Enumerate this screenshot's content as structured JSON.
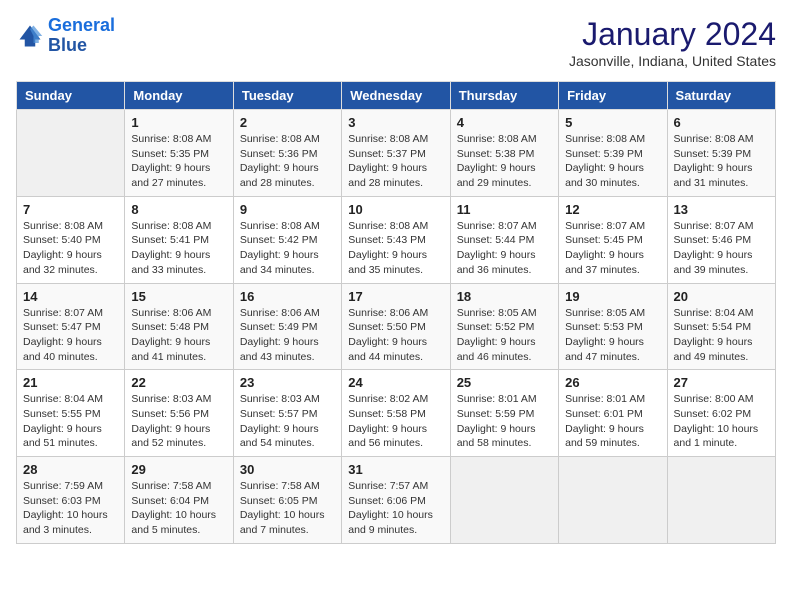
{
  "header": {
    "logo_line1": "General",
    "logo_line2": "Blue",
    "title": "January 2024",
    "subtitle": "Jasonville, Indiana, United States"
  },
  "weekdays": [
    "Sunday",
    "Monday",
    "Tuesday",
    "Wednesday",
    "Thursday",
    "Friday",
    "Saturday"
  ],
  "weeks": [
    [
      {
        "day": "",
        "sunrise": "",
        "sunset": "",
        "daylight": ""
      },
      {
        "day": "1",
        "sunrise": "Sunrise: 8:08 AM",
        "sunset": "Sunset: 5:35 PM",
        "daylight": "Daylight: 9 hours and 27 minutes."
      },
      {
        "day": "2",
        "sunrise": "Sunrise: 8:08 AM",
        "sunset": "Sunset: 5:36 PM",
        "daylight": "Daylight: 9 hours and 28 minutes."
      },
      {
        "day": "3",
        "sunrise": "Sunrise: 8:08 AM",
        "sunset": "Sunset: 5:37 PM",
        "daylight": "Daylight: 9 hours and 28 minutes."
      },
      {
        "day": "4",
        "sunrise": "Sunrise: 8:08 AM",
        "sunset": "Sunset: 5:38 PM",
        "daylight": "Daylight: 9 hours and 29 minutes."
      },
      {
        "day": "5",
        "sunrise": "Sunrise: 8:08 AM",
        "sunset": "Sunset: 5:39 PM",
        "daylight": "Daylight: 9 hours and 30 minutes."
      },
      {
        "day": "6",
        "sunrise": "Sunrise: 8:08 AM",
        "sunset": "Sunset: 5:39 PM",
        "daylight": "Daylight: 9 hours and 31 minutes."
      }
    ],
    [
      {
        "day": "7",
        "sunrise": "Sunrise: 8:08 AM",
        "sunset": "Sunset: 5:40 PM",
        "daylight": "Daylight: 9 hours and 32 minutes."
      },
      {
        "day": "8",
        "sunrise": "Sunrise: 8:08 AM",
        "sunset": "Sunset: 5:41 PM",
        "daylight": "Daylight: 9 hours and 33 minutes."
      },
      {
        "day": "9",
        "sunrise": "Sunrise: 8:08 AM",
        "sunset": "Sunset: 5:42 PM",
        "daylight": "Daylight: 9 hours and 34 minutes."
      },
      {
        "day": "10",
        "sunrise": "Sunrise: 8:08 AM",
        "sunset": "Sunset: 5:43 PM",
        "daylight": "Daylight: 9 hours and 35 minutes."
      },
      {
        "day": "11",
        "sunrise": "Sunrise: 8:07 AM",
        "sunset": "Sunset: 5:44 PM",
        "daylight": "Daylight: 9 hours and 36 minutes."
      },
      {
        "day": "12",
        "sunrise": "Sunrise: 8:07 AM",
        "sunset": "Sunset: 5:45 PM",
        "daylight": "Daylight: 9 hours and 37 minutes."
      },
      {
        "day": "13",
        "sunrise": "Sunrise: 8:07 AM",
        "sunset": "Sunset: 5:46 PM",
        "daylight": "Daylight: 9 hours and 39 minutes."
      }
    ],
    [
      {
        "day": "14",
        "sunrise": "Sunrise: 8:07 AM",
        "sunset": "Sunset: 5:47 PM",
        "daylight": "Daylight: 9 hours and 40 minutes."
      },
      {
        "day": "15",
        "sunrise": "Sunrise: 8:06 AM",
        "sunset": "Sunset: 5:48 PM",
        "daylight": "Daylight: 9 hours and 41 minutes."
      },
      {
        "day": "16",
        "sunrise": "Sunrise: 8:06 AM",
        "sunset": "Sunset: 5:49 PM",
        "daylight": "Daylight: 9 hours and 43 minutes."
      },
      {
        "day": "17",
        "sunrise": "Sunrise: 8:06 AM",
        "sunset": "Sunset: 5:50 PM",
        "daylight": "Daylight: 9 hours and 44 minutes."
      },
      {
        "day": "18",
        "sunrise": "Sunrise: 8:05 AM",
        "sunset": "Sunset: 5:52 PM",
        "daylight": "Daylight: 9 hours and 46 minutes."
      },
      {
        "day": "19",
        "sunrise": "Sunrise: 8:05 AM",
        "sunset": "Sunset: 5:53 PM",
        "daylight": "Daylight: 9 hours and 47 minutes."
      },
      {
        "day": "20",
        "sunrise": "Sunrise: 8:04 AM",
        "sunset": "Sunset: 5:54 PM",
        "daylight": "Daylight: 9 hours and 49 minutes."
      }
    ],
    [
      {
        "day": "21",
        "sunrise": "Sunrise: 8:04 AM",
        "sunset": "Sunset: 5:55 PM",
        "daylight": "Daylight: 9 hours and 51 minutes."
      },
      {
        "day": "22",
        "sunrise": "Sunrise: 8:03 AM",
        "sunset": "Sunset: 5:56 PM",
        "daylight": "Daylight: 9 hours and 52 minutes."
      },
      {
        "day": "23",
        "sunrise": "Sunrise: 8:03 AM",
        "sunset": "Sunset: 5:57 PM",
        "daylight": "Daylight: 9 hours and 54 minutes."
      },
      {
        "day": "24",
        "sunrise": "Sunrise: 8:02 AM",
        "sunset": "Sunset: 5:58 PM",
        "daylight": "Daylight: 9 hours and 56 minutes."
      },
      {
        "day": "25",
        "sunrise": "Sunrise: 8:01 AM",
        "sunset": "Sunset: 5:59 PM",
        "daylight": "Daylight: 9 hours and 58 minutes."
      },
      {
        "day": "26",
        "sunrise": "Sunrise: 8:01 AM",
        "sunset": "Sunset: 6:01 PM",
        "daylight": "Daylight: 9 hours and 59 minutes."
      },
      {
        "day": "27",
        "sunrise": "Sunrise: 8:00 AM",
        "sunset": "Sunset: 6:02 PM",
        "daylight": "Daylight: 10 hours and 1 minute."
      }
    ],
    [
      {
        "day": "28",
        "sunrise": "Sunrise: 7:59 AM",
        "sunset": "Sunset: 6:03 PM",
        "daylight": "Daylight: 10 hours and 3 minutes."
      },
      {
        "day": "29",
        "sunrise": "Sunrise: 7:58 AM",
        "sunset": "Sunset: 6:04 PM",
        "daylight": "Daylight: 10 hours and 5 minutes."
      },
      {
        "day": "30",
        "sunrise": "Sunrise: 7:58 AM",
        "sunset": "Sunset: 6:05 PM",
        "daylight": "Daylight: 10 hours and 7 minutes."
      },
      {
        "day": "31",
        "sunrise": "Sunrise: 7:57 AM",
        "sunset": "Sunset: 6:06 PM",
        "daylight": "Daylight: 10 hours and 9 minutes."
      },
      {
        "day": "",
        "sunrise": "",
        "sunset": "",
        "daylight": ""
      },
      {
        "day": "",
        "sunrise": "",
        "sunset": "",
        "daylight": ""
      },
      {
        "day": "",
        "sunrise": "",
        "sunset": "",
        "daylight": ""
      }
    ]
  ]
}
